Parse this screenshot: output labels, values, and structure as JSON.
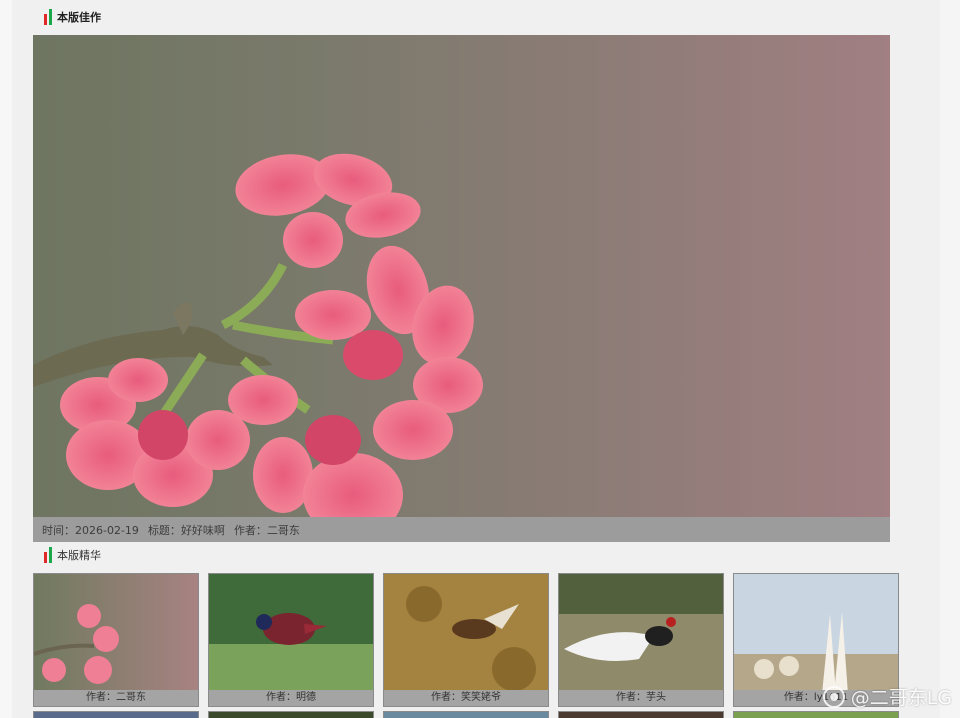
{
  "featured_section": {
    "title": "本版佳作"
  },
  "featured": {
    "time_label": "时间：",
    "time": "2026-02-19",
    "title_label": "标题：",
    "title": "好好味啊",
    "author_label": "作者：",
    "author": "二哥东"
  },
  "essence_section": {
    "title": "本版精华"
  },
  "thumbnails": [
    {
      "caption": "作者：二哥东",
      "scene": "pink-blossom"
    },
    {
      "caption": "作者：明德",
      "scene": "pheasant-green"
    },
    {
      "caption": "作者：笑笑姥爷",
      "scene": "bird-flight"
    },
    {
      "caption": "作者：芋头",
      "scene": "silver-pheasant"
    },
    {
      "caption": "作者：ly1611",
      "scene": "gannets"
    }
  ],
  "watermark": {
    "text": "@二哥东LG"
  },
  "colors": {
    "accent_red": "#e02828",
    "accent_green": "#1aa84a",
    "caption_bg": "#9c9c9c"
  }
}
